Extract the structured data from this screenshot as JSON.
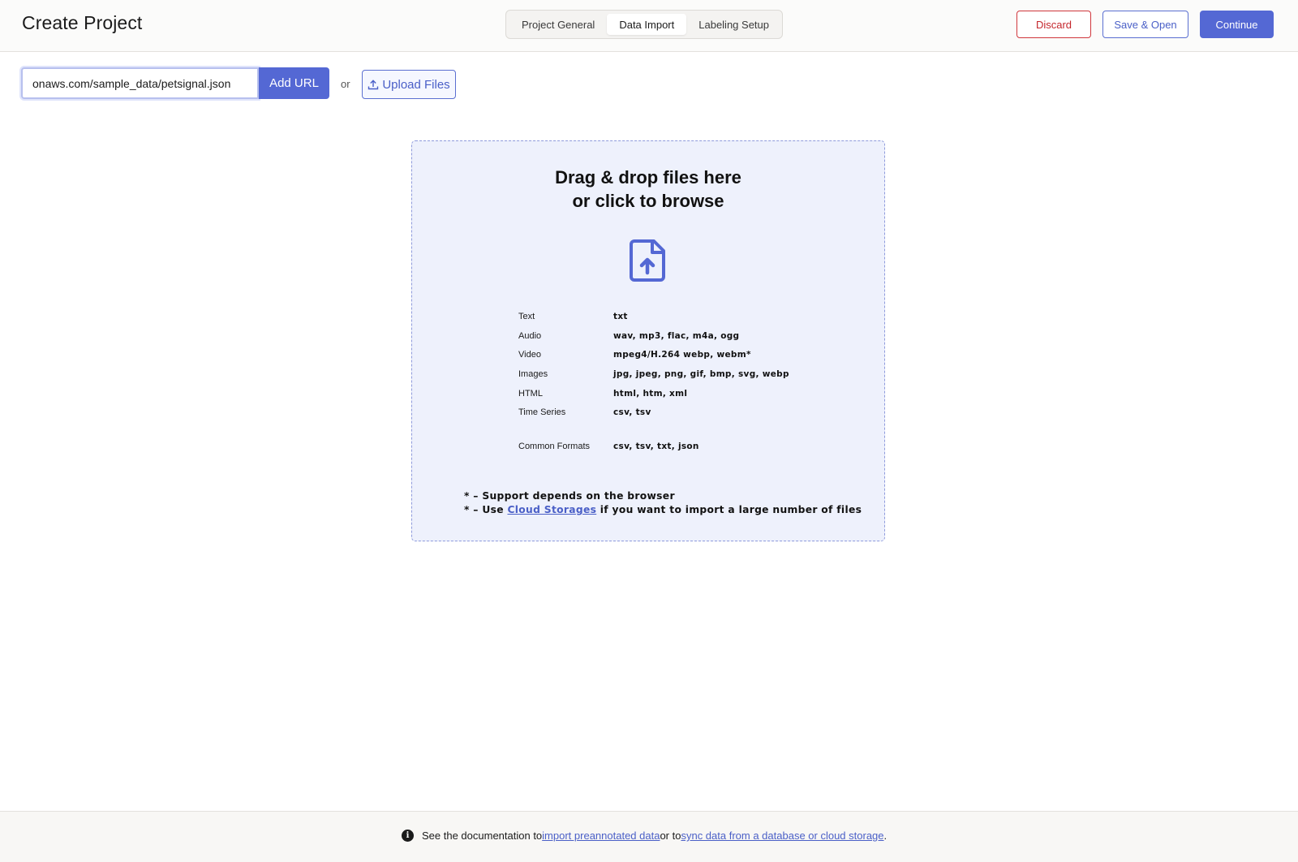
{
  "header": {
    "title": "Create Project",
    "tabs": [
      {
        "label": "Project General",
        "active": false
      },
      {
        "label": "Data Import",
        "active": true
      },
      {
        "label": "Labeling Setup",
        "active": false
      }
    ],
    "discard_label": "Discard",
    "save_open_label": "Save & Open",
    "continue_label": "Continue"
  },
  "import": {
    "url_value": "onaws.com/sample_data/petsignal.json",
    "add_url_label": "Add URL",
    "or_text": "or",
    "upload_label": "Upload Files"
  },
  "dropzone": {
    "title_line1": "Drag & drop files here",
    "title_line2": "or click to browse",
    "icon": "file-upload-icon",
    "formats": [
      {
        "type": "Text",
        "extensions": "txt"
      },
      {
        "type": "Audio",
        "extensions": "wav, mp3, flac, m4a, ogg"
      },
      {
        "type": "Video",
        "extensions": "mpeg4/H.264 webp, webm*"
      },
      {
        "type": "Images",
        "extensions": "jpg, jpeg, png, gif, bmp, svg, webp"
      },
      {
        "type": "HTML",
        "extensions": "html, htm, xml"
      },
      {
        "type": "Time Series",
        "extensions": "csv, tsv"
      }
    ],
    "common": {
      "type": "Common Formats",
      "extensions": "csv, tsv, txt, json"
    },
    "note1": "* – Support depends on the browser",
    "note2_prefix": "* – Use ",
    "note2_link": "Cloud Storages",
    "note2_suffix": " if you want to import a large number of files"
  },
  "footer": {
    "text_prefix": "See the documentation to ",
    "link1": "import preannotated data",
    "text_middle": " or to ",
    "link2": "sync data from a database or cloud storage",
    "text_suffix": "."
  },
  "colors": {
    "accent": "#5468d4",
    "danger": "#c4262c",
    "dropzone_bg": "#eef1fc"
  }
}
